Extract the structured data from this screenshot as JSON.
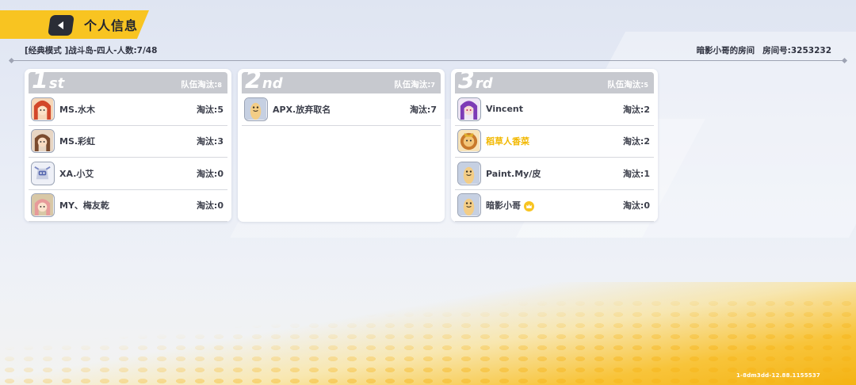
{
  "header": {
    "title": "个人信息",
    "mode_text": "[经典模式 ]战斗岛-四人-人数:7/48",
    "room_name": "暗影小哥的房间",
    "room_number": "房间号:3253232"
  },
  "teams": [
    {
      "rank_num": "1",
      "rank_suffix": "st",
      "elims_label": "队伍淘汰:",
      "elims_value": "8",
      "players": [
        {
          "name": "MS.水木",
          "kills": "淘汰:5",
          "avatar": "redhair-avatar"
        },
        {
          "name": "MS.彩虹",
          "kills": "淘汰:3",
          "avatar": "brownhair-avatar"
        },
        {
          "name": "XA.小艾",
          "kills": "淘汰:0",
          "avatar": "robot-avatar"
        },
        {
          "name": "MY、梅友乾",
          "kills": "淘汰:0",
          "avatar": "pinkhair-avatar"
        }
      ]
    },
    {
      "rank_num": "2",
      "rank_suffix": "nd",
      "elims_label": "队伍淘汰:",
      "elims_value": "7",
      "players": [
        {
          "name": "APX.放弃取名",
          "kills": "淘汰:7",
          "avatar": "default-bean-avatar"
        }
      ]
    },
    {
      "rank_num": "3",
      "rank_suffix": "rd",
      "elims_label": "队伍淘汰:",
      "elims_value": "5",
      "players": [
        {
          "name": "Vincent",
          "kills": "淘汰:2",
          "avatar": "purplehair-avatar"
        },
        {
          "name": "稻草人香菜",
          "kills": "淘汰:2",
          "avatar": "lion-avatar",
          "highlight": true
        },
        {
          "name": "Paint.My/皮",
          "kills": "淘汰:1",
          "avatar": "default-bean-avatar"
        },
        {
          "name": "暗影小哥",
          "kills": "淘汰:0",
          "avatar": "default-bean-avatar",
          "captain_icon": "crown-badge-icon"
        }
      ]
    }
  ],
  "footer": {
    "version": "1-8dm3dd-12.88.1155537"
  },
  "colors": {
    "accent": "#f8c421",
    "highlight_name": "#f2b800",
    "card_head": "#c7c9cf",
    "back_button": "#2a2d36"
  }
}
